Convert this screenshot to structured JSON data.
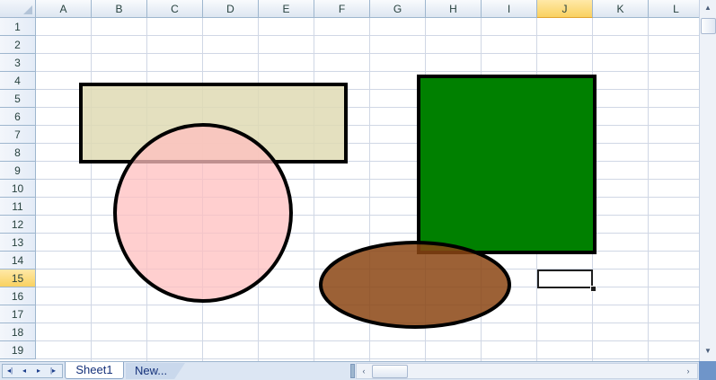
{
  "columns": [
    "A",
    "B",
    "C",
    "D",
    "E",
    "F",
    "G",
    "H",
    "I",
    "J",
    "K",
    "L"
  ],
  "rows": [
    "1",
    "2",
    "3",
    "4",
    "5",
    "6",
    "7",
    "8",
    "9",
    "10",
    "11",
    "12",
    "13",
    "14",
    "15",
    "16",
    "17",
    "18",
    "19"
  ],
  "selection": {
    "column": "J",
    "row": "15"
  },
  "sheet_tabs": [
    {
      "label": "Sheet1",
      "active": true
    },
    {
      "label": "New...",
      "active": false
    }
  ],
  "icons": {
    "nav_first": "◂|",
    "nav_prev": "◂",
    "nav_next": "▸",
    "nav_last": "|▸",
    "scroll_up": "▲",
    "scroll_down": "▼",
    "scroll_left": "‹",
    "scroll_right": "›"
  },
  "shapes": [
    {
      "name": "rectangle-shape",
      "fill": "#dfdbb4",
      "opacity": 0.85,
      "stroke": "#000000"
    },
    {
      "name": "circle-shape",
      "fill": "#ffbfbf",
      "opacity": 0.75,
      "stroke": "#000000"
    },
    {
      "name": "square-shape",
      "fill": "#008000",
      "opacity": 1,
      "stroke": "#000000"
    },
    {
      "name": "ellipse-shape",
      "fill": "#8b4513",
      "opacity": 0.85,
      "stroke": "#000000"
    }
  ],
  "colors": {
    "header_bg": "#dde6f1",
    "header_selected": "#f9d160",
    "gridline": "#d0d7e5"
  }
}
